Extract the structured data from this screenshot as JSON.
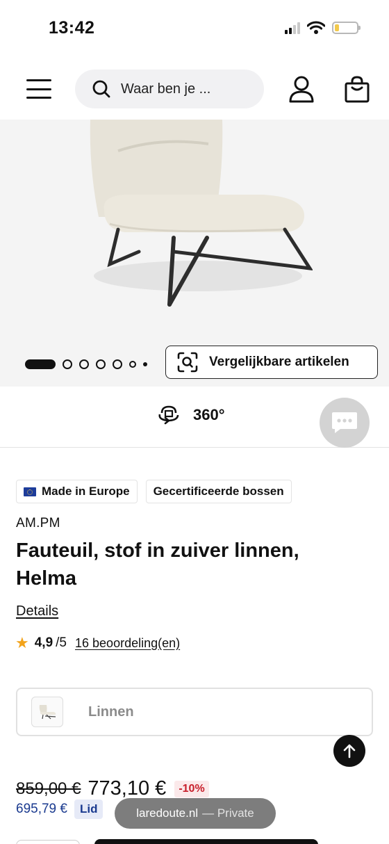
{
  "status_bar": {
    "time": "13:42"
  },
  "header": {
    "search_placeholder": "Waar ben je ..."
  },
  "gallery": {
    "slide_count": 7,
    "active_slide": 1,
    "similar_button_label": "Vergelijkbare artikelen"
  },
  "view360": {
    "label": "360°"
  },
  "badges": [
    "Made in Europe",
    "Gecertificeerde bossen"
  ],
  "product": {
    "brand": "AM.PM",
    "title": "Fauteuil, stof in zuiver linnen, Helma",
    "details_link": "Details",
    "rating_score": "4,9",
    "rating_max": "/5",
    "reviews_link": "16 beoordeling(en)",
    "variant_label": "Linnen",
    "old_price": "859,00 €",
    "new_price": "773,10 €",
    "discount": "-10%",
    "member_price": "695,79 €",
    "member_badge": "Lid"
  },
  "browser": {
    "domain": "laredoute.nl",
    "mode": "— Private"
  },
  "colors": {
    "accent": "#111111",
    "discount_red": "#c8202c",
    "member_blue": "#1a3a8f",
    "star": "#f2a31b"
  }
}
